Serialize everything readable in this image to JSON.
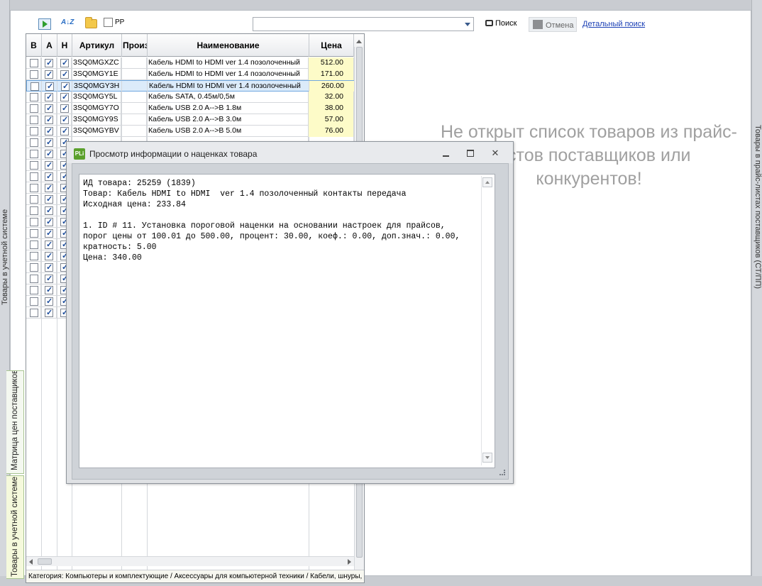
{
  "side_tabs": {
    "left_label": "Товары в учетной системе",
    "right_label": "Товары в прайс-листах поставщиков (СТ/ПП)",
    "matrix_tab": "Матрица цен поставщиков",
    "account_tab": "Товары в учетной системе"
  },
  "toolbar": {
    "pp_label": "PP",
    "search_value": "",
    "search_button": "Поиск",
    "cancel_button": "Отмена",
    "advanced_search_link": "Детальный поиск"
  },
  "grid": {
    "columns": [
      "В",
      "А",
      "Н",
      "Артикул",
      "Производитель",
      "Наименование",
      "Цена"
    ],
    "rows": [
      {
        "v": false,
        "a": true,
        "n": true,
        "sku": "3SQ0MGXZC",
        "maker": "",
        "name": "Кабель HDMI to HDMI  ver 1.4 позолоченный",
        "price": "512.00",
        "selected": false
      },
      {
        "v": false,
        "a": true,
        "n": true,
        "sku": "3SQ0MGY1E",
        "maker": "",
        "name": "Кабель HDMI to HDMI  ver 1.4 позолоченный",
        "price": "171.00",
        "selected": false
      },
      {
        "v": false,
        "a": true,
        "n": true,
        "sku": "3SQ0MGY3H",
        "maker": "",
        "name": "Кабель HDMI to HDMI  ver 1.4 позолоченный",
        "price": "260.00",
        "selected": true
      },
      {
        "v": false,
        "a": true,
        "n": true,
        "sku": "3SQ0MGY5L",
        "maker": "",
        "name": "Кабель SATA, 0.45м/0,5м",
        "price": "32.00",
        "selected": false
      },
      {
        "v": false,
        "a": true,
        "n": true,
        "sku": "3SQ0MGY7O",
        "maker": "",
        "name": "Кабель USB 2.0 A-->B 1.8м",
        "price": "38.00",
        "selected": false
      },
      {
        "v": false,
        "a": true,
        "n": true,
        "sku": "3SQ0MGY9S",
        "maker": "",
        "name": "Кабель USB 2.0 A-->B 3.0м",
        "price": "57.00",
        "selected": false
      },
      {
        "v": false,
        "a": true,
        "n": true,
        "sku": "3SQ0MGYBV",
        "maker": "",
        "name": "Кабель USB 2.0 A-->B 5.0м",
        "price": "76.00",
        "selected": false
      },
      {
        "v": false,
        "a": true,
        "n": true,
        "sku": "",
        "maker": "",
        "name": "",
        "price": "",
        "selected": false
      },
      {
        "v": false,
        "a": true,
        "n": true,
        "sku": "",
        "maker": "",
        "name": "",
        "price": "",
        "selected": false
      },
      {
        "v": false,
        "a": true,
        "n": true,
        "sku": "",
        "maker": "",
        "name": "",
        "price": "",
        "selected": false
      },
      {
        "v": false,
        "a": true,
        "n": true,
        "sku": "",
        "maker": "",
        "name": "",
        "price": "",
        "selected": false
      },
      {
        "v": false,
        "a": true,
        "n": true,
        "sku": "",
        "maker": "",
        "name": "",
        "price": "",
        "selected": false
      },
      {
        "v": false,
        "a": true,
        "n": true,
        "sku": "",
        "maker": "",
        "name": "",
        "price": "",
        "selected": false
      },
      {
        "v": false,
        "a": true,
        "n": true,
        "sku": "",
        "maker": "",
        "name": "",
        "price": "",
        "selected": false
      },
      {
        "v": false,
        "a": true,
        "n": true,
        "sku": "",
        "maker": "",
        "name": "",
        "price": "",
        "selected": false
      },
      {
        "v": false,
        "a": true,
        "n": true,
        "sku": "",
        "maker": "",
        "name": "",
        "price": "",
        "selected": false
      },
      {
        "v": false,
        "a": true,
        "n": true,
        "sku": "",
        "maker": "",
        "name": "",
        "price": "",
        "selected": false
      },
      {
        "v": false,
        "a": true,
        "n": true,
        "sku": "",
        "maker": "",
        "name": "",
        "price": "",
        "selected": false
      },
      {
        "v": false,
        "a": true,
        "n": true,
        "sku": "",
        "maker": "",
        "name": "",
        "price": "",
        "selected": false
      },
      {
        "v": false,
        "a": true,
        "n": true,
        "sku": "",
        "maker": "",
        "name": "",
        "price": "",
        "selected": false
      },
      {
        "v": false,
        "a": true,
        "n": true,
        "sku": "",
        "maker": "",
        "name": "",
        "price": "",
        "selected": false
      },
      {
        "v": false,
        "a": true,
        "n": true,
        "sku": "",
        "maker": "",
        "name": "",
        "price": "",
        "selected": false
      },
      {
        "v": false,
        "a": true,
        "n": true,
        "sku": "",
        "maker": "",
        "name": "",
        "price": "",
        "selected": false
      }
    ],
    "status": "Категория: Компьютеры и комплектующие / Аксессуары для компьютерной техники / Кабели, шнуры, удлинители"
  },
  "right_panel": {
    "message": "Не открыт список товаров из прайс-листов поставщиков или конкурентов!"
  },
  "dialog": {
    "logo": "PLi",
    "title": "Просмотр информации о наценках товара",
    "lines": [
      "ИД товара: 25259 (1839)",
      "Товар: Кабель HDMI to HDMI  ver 1.4 позолоченный контакты передача",
      "Исходная цена: 233.84",
      "",
      "1. ID # 11. Установка пороговой наценки на основании настроек для прайсов,",
      "порог цены от 100.01 до 500.00, процент: 30.00, коеф.: 0.00, доп.знач.: 0.00,",
      "кратность: 5.00",
      "Цена: 340.00"
    ]
  },
  "colors": {
    "price_bg": "#fdfbc8",
    "selected_row_bg": "#dcebfa",
    "link": "#1a3fb5",
    "message_text": "#a0a0a0"
  }
}
